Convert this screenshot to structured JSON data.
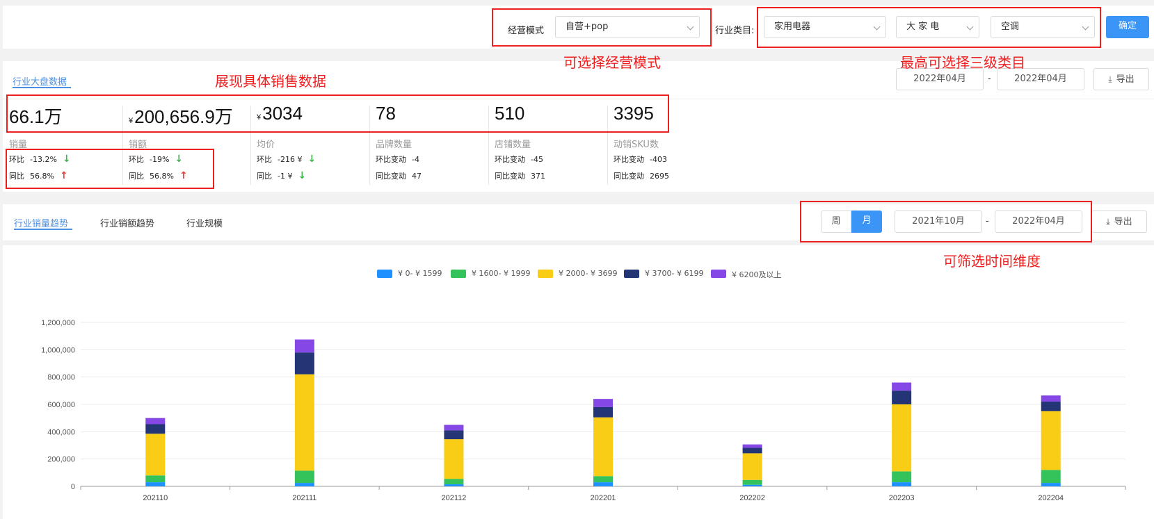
{
  "filter_bar": {
    "mode_label": "经营模式",
    "mode_value": "自营+pop",
    "category_label": "行业类目:",
    "category_l1": "家用电器",
    "category_l2": "大 家 电",
    "category_l3": "空调",
    "confirm_label": "确定"
  },
  "annotations": {
    "mode": "可选择经营模式",
    "category": "最高可选择三级类目",
    "sales": "展现具体销售数据",
    "time": "可筛选时间维度"
  },
  "overview": {
    "tab_label": "行业大盘数据",
    "date_from": "2022年04月",
    "date_sep": "-",
    "date_to": "2022年04月",
    "export_label": "导出",
    "metrics": [
      {
        "currency": "",
        "value": "66.1万",
        "label": "销量",
        "row1_label": "环比",
        "row1_value": "-13.2%",
        "row1_dir": "down",
        "row2_label": "同比",
        "row2_value": "56.8%",
        "row2_dir": "up"
      },
      {
        "currency": "¥",
        "value": "200,656.9万",
        "label": "销额",
        "row1_label": "环比",
        "row1_value": "-19%",
        "row1_dir": "down",
        "row2_label": "同比",
        "row2_value": "56.8%",
        "row2_dir": "up"
      },
      {
        "currency": "¥",
        "value": "3034",
        "label": "均价",
        "row1_label": "环比",
        "row1_value": "-216 ¥",
        "row1_dir": "down",
        "row2_label": "同比",
        "row2_value": "-1 ¥",
        "row2_dir": "down"
      },
      {
        "currency": "",
        "value": "78",
        "label": "品牌数量",
        "row1_label": "环比变动",
        "row1_value": "-4",
        "row1_dir": "",
        "row2_label": "同比变动",
        "row2_value": "47",
        "row2_dir": ""
      },
      {
        "currency": "",
        "value": "510",
        "label": "店铺数量",
        "row1_label": "环比变动",
        "row1_value": "-45",
        "row1_dir": "",
        "row2_label": "同比变动",
        "row2_value": "371",
        "row2_dir": ""
      },
      {
        "currency": "",
        "value": "3395",
        "label": "动销SKU数",
        "row1_label": "环比变动",
        "row1_value": "-403",
        "row1_dir": "",
        "row2_label": "同比变动",
        "row2_value": "2695",
        "row2_dir": ""
      }
    ]
  },
  "trend": {
    "tabs": [
      "行业销量趋势",
      "行业销额趋势",
      "行业规模"
    ],
    "week_label": "周",
    "month_label": "月",
    "date_from": "2021年10月",
    "date_sep": "-",
    "date_to": "2022年04月",
    "export_label": "导出"
  },
  "icons": {
    "chevron": "chevron-down-icon",
    "export": "download-icon",
    "down": "arrow-down-icon",
    "up": "arrow-up-icon"
  },
  "chart_data": {
    "type": "bar",
    "stacked": true,
    "categories": [
      "202110",
      "202111",
      "202112",
      "202201",
      "202202",
      "202203",
      "202204"
    ],
    "series": [
      {
        "name": "¥ 0- ¥ 1599",
        "color": "#1e90ff",
        "values": [
          30000,
          25000,
          15000,
          30000,
          12000,
          30000,
          25000
        ]
      },
      {
        "name": "¥ 1600- ¥ 1999",
        "color": "#34c25a",
        "values": [
          50000,
          90000,
          40000,
          45000,
          35000,
          80000,
          95000
        ]
      },
      {
        "name": "¥ 2000- ¥ 3699",
        "color": "#f9cc16",
        "values": [
          305000,
          705000,
          290000,
          430000,
          195000,
          490000,
          430000
        ]
      },
      {
        "name": "¥ 3700- ¥ 6199",
        "color": "#233574",
        "values": [
          70000,
          160000,
          65000,
          75000,
          40000,
          100000,
          70000
        ]
      },
      {
        "name": "¥ 6200及以上",
        "color": "#8547e6",
        "values": [
          45000,
          95000,
          40000,
          60000,
          25000,
          60000,
          45000
        ]
      }
    ],
    "yticks": [
      "0",
      "200,000",
      "400,000",
      "600,000",
      "800,000",
      "1,000,000",
      "1,200,000"
    ],
    "ylim": [
      0,
      1200000
    ],
    "grid": true,
    "legend": "top"
  }
}
